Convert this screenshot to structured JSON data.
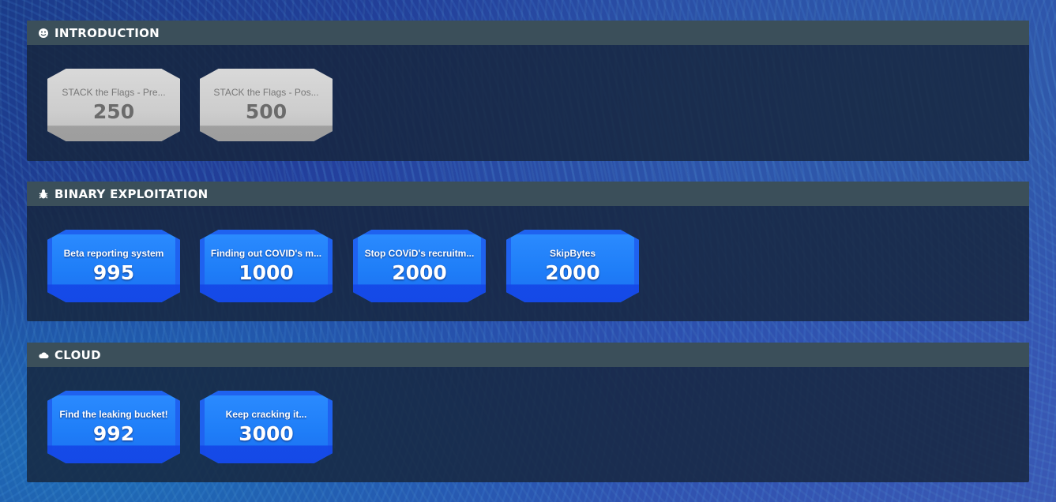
{
  "categories": [
    {
      "title": "INTRODUCTION",
      "icon": "smiley-icon",
      "challenges": [
        {
          "name": "STACK the Flags - Pre...",
          "points": "250",
          "state": "grey"
        },
        {
          "name": "STACK the Flags - Pos...",
          "points": "500",
          "state": "grey"
        }
      ]
    },
    {
      "title": "BINARY EXPLOITATION",
      "icon": "bug-icon",
      "challenges": [
        {
          "name": "Beta reporting system",
          "points": "995",
          "state": "blue"
        },
        {
          "name": "Finding out COVID's m...",
          "points": "1000",
          "state": "blue"
        },
        {
          "name": "Stop COViD's recruitm...",
          "points": "2000",
          "state": "blue"
        },
        {
          "name": "SkipBytes",
          "points": "2000",
          "state": "blue"
        }
      ]
    },
    {
      "title": "CLOUD",
      "icon": "cloud-icon",
      "challenges": [
        {
          "name": "Find the leaking bucket!",
          "points": "992",
          "state": "blue"
        },
        {
          "name": "Keep cracking it...",
          "points": "3000",
          "state": "blue"
        }
      ]
    }
  ]
}
